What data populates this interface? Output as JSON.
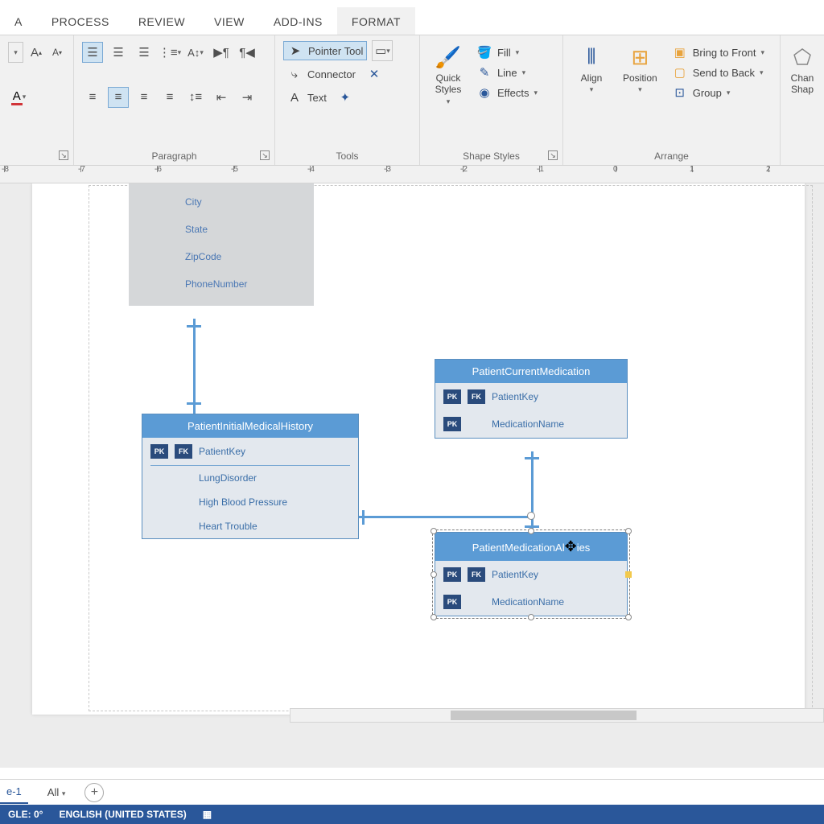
{
  "tabs": {
    "a": "A",
    "process": "PROCESS",
    "review": "REVIEW",
    "view": "VIEW",
    "addins": "ADD-INS",
    "format": "FORMAT"
  },
  "ribbon": {
    "font": {
      "grow": "A",
      "shrink": "A",
      "fontcolor": "A"
    },
    "paragraph": {
      "label": "Paragraph"
    },
    "tools": {
      "label": "Tools",
      "pointer": "Pointer Tool",
      "connector": "Connector",
      "text": "Text"
    },
    "shapestyles": {
      "label": "Shape Styles",
      "quick": "Quick\nStyles",
      "fill": "Fill",
      "line": "Line",
      "effects": "Effects"
    },
    "arrange": {
      "label": "Arrange",
      "align": "Align",
      "position": "Position",
      "front": "Bring to Front",
      "back": "Send to Back",
      "group": "Group"
    },
    "change": {
      "label": "Chan\nShap"
    }
  },
  "ruler": {
    "marks": [
      "-8",
      "-7",
      "-6",
      "-5",
      "-4",
      "-3",
      "-2",
      "-1",
      "0",
      "1",
      "2"
    ]
  },
  "entities": {
    "e1": {
      "attrs": [
        "City",
        "State",
        "ZipCode",
        "PhoneNumber"
      ]
    },
    "e2": {
      "title": "PatientInitialMedicalHistory",
      "key": "PatientKey",
      "attrs": [
        "LungDisorder",
        "High Blood Pressure",
        "Heart Trouble"
      ]
    },
    "e3": {
      "title": "PatientCurrentMedication",
      "k1": "PatientKey",
      "k2": "MedicationName"
    },
    "e4": {
      "title": "PatientMedicationAl",
      "titleEnd": "ies",
      "k1": "PatientKey",
      "k2": "MedicationName"
    }
  },
  "badges": {
    "pk": "PK",
    "fk": "FK"
  },
  "pagetabs": {
    "p1": "e-1",
    "all": "All"
  },
  "status": {
    "angle": "GLE: 0°",
    "lang": "ENGLISH (UNITED STATES)"
  }
}
